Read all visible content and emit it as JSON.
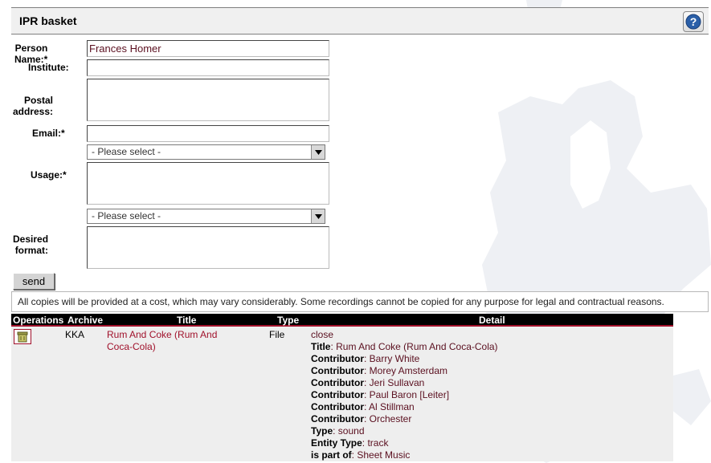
{
  "header": {
    "title": "IPR basket",
    "help_icon": "help-question-icon"
  },
  "form": {
    "person_name": {
      "label": "Person Name:*",
      "value": "Frances Homer"
    },
    "institute": {
      "label": "Institute:",
      "value": ""
    },
    "postal_address": {
      "label": "Postal address:",
      "value": ""
    },
    "email": {
      "label": "Email:*",
      "value": ""
    },
    "usage_select": {
      "selected": "- Please select -"
    },
    "usage": {
      "label": "Usage:*",
      "value": ""
    },
    "format_select": {
      "selected": "- Please select -"
    },
    "desired_format": {
      "label": "Desired format:",
      "value": ""
    },
    "send_label": "send"
  },
  "notice": "All copies will be provided at a cost, which may vary considerably. Some recordings cannot be copied for any purpose for legal and contractual reasons.",
  "table": {
    "columns": [
      "Operations",
      "Archive",
      "Title",
      "Type",
      "Detail"
    ],
    "rows": [
      {
        "archive": "KKA",
        "title_line1": "Rum And Coke (Rum And",
        "title_line2": "Coca-Cola)",
        "type": "File",
        "detail_toggle": "close",
        "details": [
          {
            "key": "Title",
            "value": "Rum And Coke (Rum And Coca-Cola)"
          },
          {
            "key": "Contributor",
            "value": "Barry White"
          },
          {
            "key": "Contributor",
            "value": "Morey Amsterdam"
          },
          {
            "key": "Contributor",
            "value": "Jeri Sullavan"
          },
          {
            "key": "Contributor",
            "value": "Paul Baron [Leiter]"
          },
          {
            "key": "Contributor",
            "value": "Al Stillman"
          },
          {
            "key": "Contributor",
            "value": "Orchester"
          },
          {
            "key": "Type",
            "value": "sound"
          },
          {
            "key": "Entity Type",
            "value": "track"
          },
          {
            "key": "is part of",
            "value": "Sheet Music"
          }
        ]
      }
    ]
  },
  "colors": {
    "accent": "#a0102a",
    "header_bg": "#f0f0f0",
    "table_header": "#000000",
    "row_bg": "#eeeeee"
  }
}
